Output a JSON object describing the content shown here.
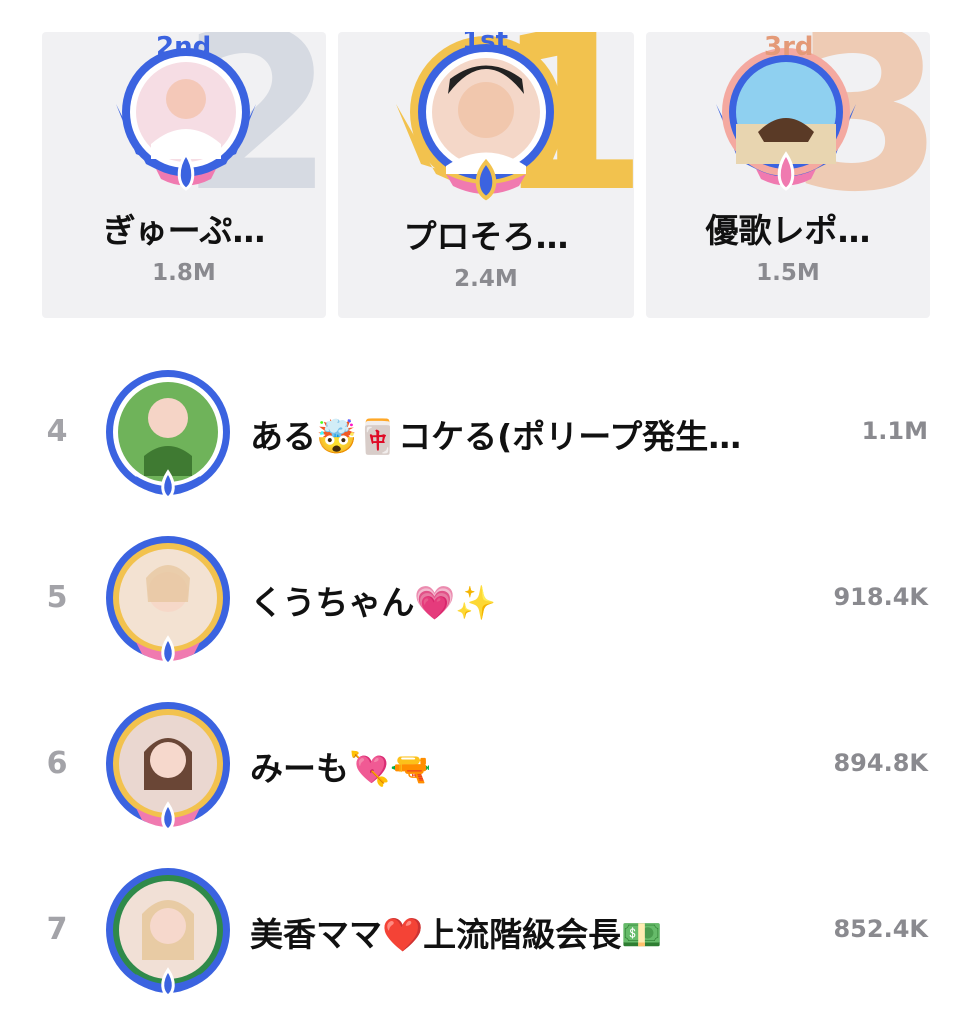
{
  "top3": [
    {
      "rank_label": "2nd",
      "big_number": "2",
      "name": "ぎゅーぷ…",
      "score": "1.8M"
    },
    {
      "rank_label": "1st",
      "big_number": "1",
      "name": "プロそろ…",
      "score": "2.4M"
    },
    {
      "rank_label": "3rd",
      "big_number": "3",
      "name": "優歌レポ…",
      "score": "1.5M"
    }
  ],
  "list": [
    {
      "rank": "4",
      "name": "ある🤯🀄コケる(ポリープ発生…",
      "score": "1.1M"
    },
    {
      "rank": "5",
      "name": "くうちゃん💗✨",
      "score": "918.4K"
    },
    {
      "rank": "6",
      "name": "みーも💘🔫",
      "score": "894.8K"
    },
    {
      "rank": "7",
      "name": "美香ママ❤️上流階級会長💵",
      "score": "852.4K"
    }
  ],
  "badges": {
    "first": "1st"
  },
  "colors": {
    "gold": "#f2c24e",
    "silver": "#d3d8e0",
    "bronze": "#eecbb4",
    "ring_blue": "#3b63e0",
    "ring_pink": "#f07ab0",
    "rank_gray": "#a3a3a8"
  }
}
